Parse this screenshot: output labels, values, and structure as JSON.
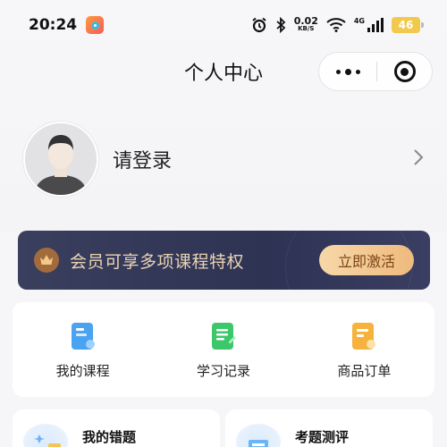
{
  "status_bar": {
    "time": "20:24",
    "speed_value": "0.02",
    "speed_unit": "KB/S",
    "network": "4G",
    "battery": "46",
    "icons": [
      "app-badge-icon",
      "alarm-icon",
      "bluetooth-icon",
      "wifi-icon",
      "signal-icon",
      "battery-icon"
    ]
  },
  "nav": {
    "title": "个人中心",
    "icons": [
      "more-icon",
      "close-target-icon"
    ]
  },
  "profile": {
    "login_text": "请登录",
    "icons": [
      "avatar-placeholder",
      "chevron-right-icon"
    ]
  },
  "vip": {
    "text": "会员可享多项课程特权",
    "button": "立即激活",
    "icon": "crown-icon"
  },
  "quick_links": [
    {
      "label": "我的课程",
      "icon": "course-icon",
      "color": "#4aa3f0"
    },
    {
      "label": "学习记录",
      "icon": "study-record-icon",
      "color": "#3cc76a"
    },
    {
      "label": "商品订单",
      "icon": "order-icon",
      "color": "#f6b23c"
    }
  ],
  "cards": [
    {
      "title": "我的错题",
      "icon": "wrong-questions-icon"
    },
    {
      "title": "考题测评",
      "icon": "exam-assessment-icon"
    }
  ],
  "colors": {
    "background": "#f6f6f8",
    "vip_bg": "#2e3354",
    "vip_text": "#ead3b2",
    "vip_button": "#eeba7d"
  }
}
